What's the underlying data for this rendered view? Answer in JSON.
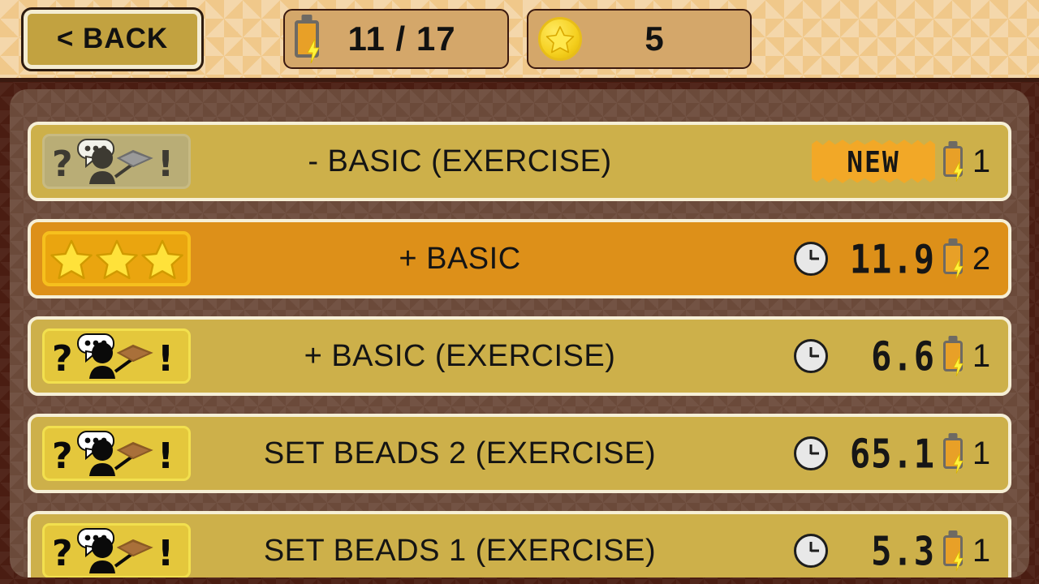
{
  "header": {
    "back_button": {
      "label": "< BACK",
      "icon": "chevron-left-icon"
    },
    "battery_counter": {
      "icon": "battery-icon",
      "value": "11 / 17"
    },
    "star_counter": {
      "icon": "star-coin-icon",
      "value": "5"
    }
  },
  "levels": [
    {
      "title": "- BASIC (EXERCISE)",
      "icon_type": "tutorial-done",
      "icon_name": "tutorial-completed-icon",
      "badge": "NEW",
      "time": null,
      "cost": "1",
      "selected": false
    },
    {
      "title": "+ BASIC",
      "icon_type": "stars",
      "icon_name": "three-stars-icon",
      "stars": 3,
      "badge": null,
      "time": "11.9",
      "cost": "2",
      "selected": true
    },
    {
      "title": "+ BASIC (EXERCISE)",
      "icon_type": "tutorial",
      "icon_name": "tutorial-icon",
      "badge": null,
      "time": "6.6",
      "cost": "1",
      "selected": false
    },
    {
      "title": "SET BEADS 2 (EXERCISE)",
      "icon_type": "tutorial",
      "icon_name": "tutorial-icon",
      "badge": null,
      "time": "65.1",
      "cost": "1",
      "selected": false
    },
    {
      "title": "SET BEADS 1 (EXERCISE)",
      "icon_type": "tutorial",
      "icon_name": "tutorial-icon",
      "badge": null,
      "time": "5.3",
      "cost": "1",
      "selected": false
    }
  ],
  "colors": {
    "page_background": "#4a1d12",
    "header_background": "#f0c88a",
    "panel_background": "#6b4a3a",
    "row_background": "#cdb04a",
    "row_selected_background": "#dd9019",
    "row_border": "#f6efd6",
    "button_fill": "#c2a240",
    "counter_fill": "#d4a76a",
    "badge_orange": "#f2a827",
    "star_yellow": "#f5d020",
    "battery_orange": "#e8a027",
    "text_dark": "#141414"
  }
}
